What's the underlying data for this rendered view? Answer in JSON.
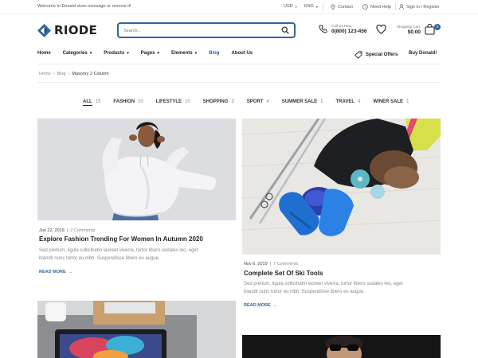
{
  "topbar": {
    "welcome": "Welcome to Donald store message or remove it!",
    "currency": "USD",
    "language": "ENG",
    "contact": "Contact",
    "help": "Need Help",
    "signin": "Sign in / Register"
  },
  "header": {
    "logo": "RIODE",
    "search_placeholder": "Search...",
    "call_label": "Call Us Now:",
    "call_number": "0(800) 123-456",
    "cart_label": "Shopping Cart:",
    "cart_total": "$0.00",
    "cart_count": "0"
  },
  "nav": {
    "items": [
      {
        "label": "Home"
      },
      {
        "label": "Categories"
      },
      {
        "label": "Products"
      },
      {
        "label": "Pages"
      },
      {
        "label": "Elements"
      },
      {
        "label": "Blog"
      },
      {
        "label": "About Us"
      }
    ],
    "special_offers": "Special Offers",
    "buy": "Buy Donald!"
  },
  "breadcrumb": {
    "home": "Home",
    "blog": "Blog",
    "current": "Masonry 2 Column"
  },
  "filters": [
    {
      "label": "All",
      "count": "15"
    },
    {
      "label": "Fashion",
      "count": "10"
    },
    {
      "label": "Lifestyle",
      "count": "10"
    },
    {
      "label": "Shopping",
      "count": "2"
    },
    {
      "label": "Sport",
      "count": "4"
    },
    {
      "label": "Summer Sale",
      "count": "1"
    },
    {
      "label": "Travel",
      "count": "4"
    },
    {
      "label": "Winer Sale",
      "count": "1"
    }
  ],
  "posts": [
    {
      "date": "Jun 22, 2018",
      "comments": "2 Comments",
      "title": "Explore Fashion Trending For Women In Autumn 2020",
      "excerpt_1": "Sed pretium, ligula sollicitudin laoreet viverra, tortor libero sodales leo, eget",
      "excerpt_2": "blandit nunc tortor eu nibh. Suspendisse libero eu augue.",
      "read_more": "READ MORE"
    },
    {
      "date": "Nov 6, 2019",
      "comments": "7 Comments",
      "title": "Complete Set Of Ski Tools",
      "excerpt_1": "Sed pretium, ligula sollicitudin laoreet viverra, tortor libero sodales leo, eget",
      "excerpt_2": "blandit nunc tortor eu nibh. Suspendisse libero eu augue.",
      "read_more": "READ MORE"
    }
  ],
  "colors": {
    "accent": "#336699",
    "text": "#222222",
    "muted": "#888888"
  }
}
